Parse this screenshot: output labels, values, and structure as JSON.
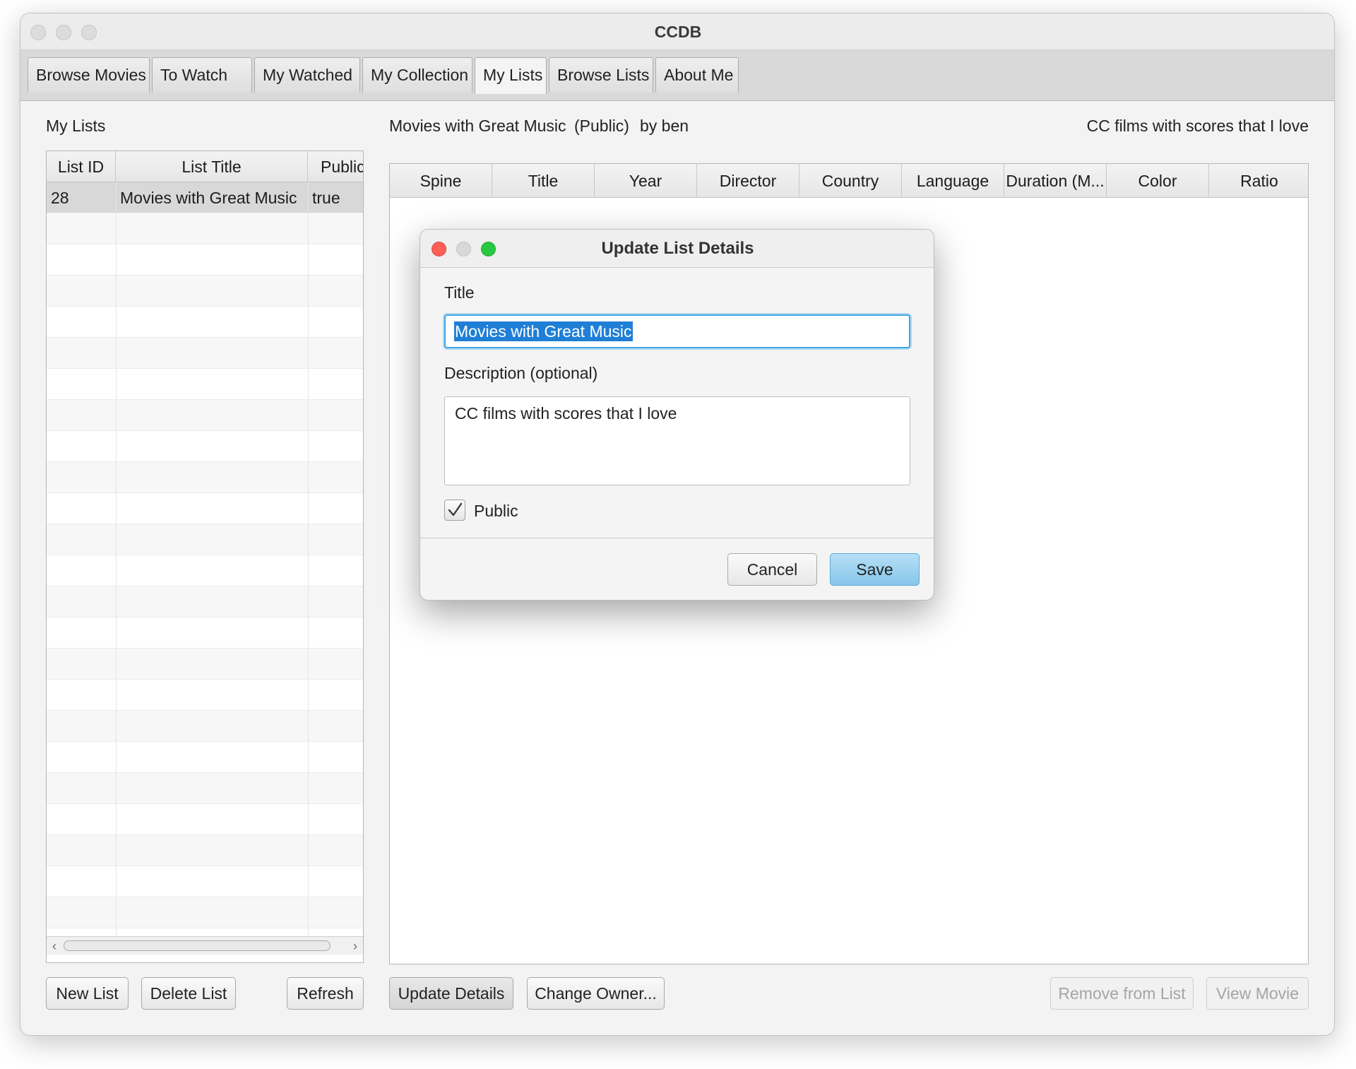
{
  "window": {
    "title": "CCDB"
  },
  "tabs": [
    "Browse Movies",
    "To Watch",
    "My Watched",
    "My Collection",
    "My Lists",
    "Browse Lists",
    "About Me"
  ],
  "active_tab": "My Lists",
  "left_panel": {
    "heading": "My Lists",
    "columns": [
      "List ID",
      "List Title",
      "Public"
    ],
    "rows": [
      {
        "id": "28",
        "title": "Movies with Great Music",
        "public": "true"
      }
    ],
    "buttons": {
      "new_list": "New List",
      "delete_list": "Delete List",
      "refresh": "Refresh"
    }
  },
  "right_panel": {
    "list_title": "Movies with Great Music",
    "visibility": "(Public)",
    "owner": "by ben",
    "description": "CC films with scores that I love",
    "columns": [
      "Spine",
      "Title",
      "Year",
      "Director",
      "Country",
      "Language",
      "Duration (M...",
      "Color",
      "Ratio"
    ],
    "buttons": {
      "update_details": "Update Details",
      "change_owner": "Change Owner...",
      "remove_from_list": "Remove from List",
      "view_movie": "View Movie"
    }
  },
  "dialog": {
    "title": "Update List Details",
    "title_label": "Title",
    "title_value": "Movies with Great Music",
    "description_label": "Description (optional)",
    "description_value": "CC films with scores that I love",
    "public_label": "Public",
    "public_checked": true,
    "cancel_label": "Cancel",
    "save_label": "Save",
    "colors": {
      "close": "#fe5f57",
      "minimize": "#d8d8d8",
      "zoom": "#28c840",
      "accent": "#3ea6e6",
      "selection": "#1f7fd6"
    }
  }
}
